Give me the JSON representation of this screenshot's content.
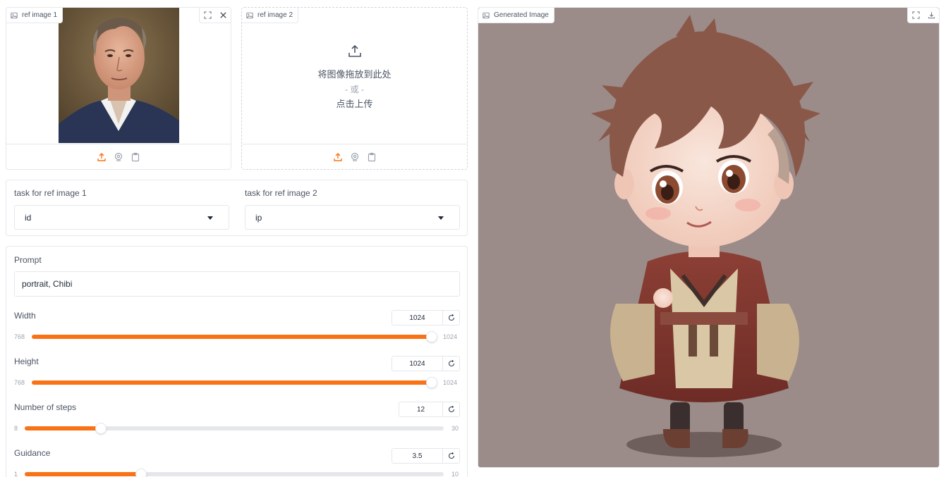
{
  "ref1": {
    "label": "ref image 1"
  },
  "ref2": {
    "label": "ref image 2",
    "drop_text": "将图像拖放到此处",
    "or_text": "- 或 -",
    "click_text": "点击上传"
  },
  "tasks": {
    "task1_label": "task for ref image 1",
    "task1_value": "id",
    "task2_label": "task for ref image 2",
    "task2_value": "ip"
  },
  "prompt": {
    "label": "Prompt",
    "value": "portrait, Chibi"
  },
  "sliders": [
    {
      "label": "Width",
      "value": "1024",
      "min": "768",
      "max": "1024",
      "fraction": 1.0
    },
    {
      "label": "Height",
      "value": "1024",
      "min": "768",
      "max": "1024",
      "fraction": 1.0
    },
    {
      "label": "Number of steps",
      "value": "12",
      "min": "8",
      "max": "30",
      "fraction": 0.1818
    },
    {
      "label": "Guidance",
      "value": "3.5",
      "min": "1",
      "max": "10",
      "fraction": 0.2778
    }
  ],
  "generated": {
    "label": "Generated Image"
  },
  "colors": {
    "accent": "#f97316",
    "border": "#e5e7eb",
    "gen_background": "#9b8b89"
  }
}
